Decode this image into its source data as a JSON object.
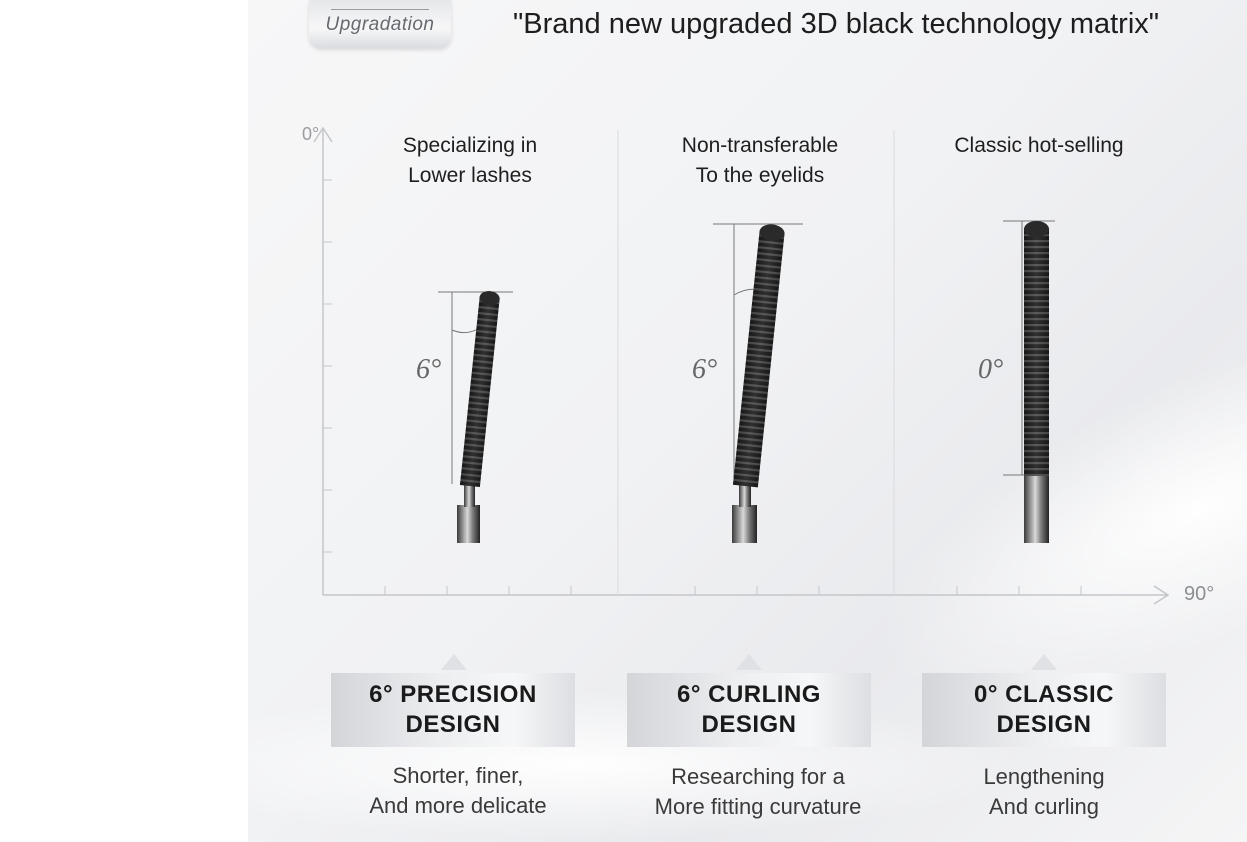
{
  "badge": {
    "label": "Upgradation"
  },
  "headline": "\"Brand new upgraded 3D black technology matrix\"",
  "axis": {
    "y_label": "0°",
    "x_label": "90°"
  },
  "products": [
    {
      "title_lines": [
        "Specializing in",
        "Lower lashes"
      ],
      "angle_label": "6°",
      "angle_deg": 6,
      "design_lines": [
        "6° PRECISION",
        "DESIGN"
      ],
      "desc_lines": [
        "Shorter, finer,",
        "And more delicate"
      ]
    },
    {
      "title_lines": [
        "Non-transferable",
        "To the eyelids"
      ],
      "angle_label": "6°",
      "angle_deg": 6,
      "design_lines": [
        "6° CURLING",
        "DESIGN"
      ],
      "desc_lines": [
        "Researching for a",
        "More fitting curvature"
      ]
    },
    {
      "title_lines": [
        "Classic hot-selling"
      ],
      "angle_label": "0°",
      "angle_deg": 0,
      "design_lines": [
        "0° CLASSIC",
        "DESIGN"
      ],
      "desc_lines": [
        "Lengthening",
        "And curling"
      ]
    }
  ]
}
